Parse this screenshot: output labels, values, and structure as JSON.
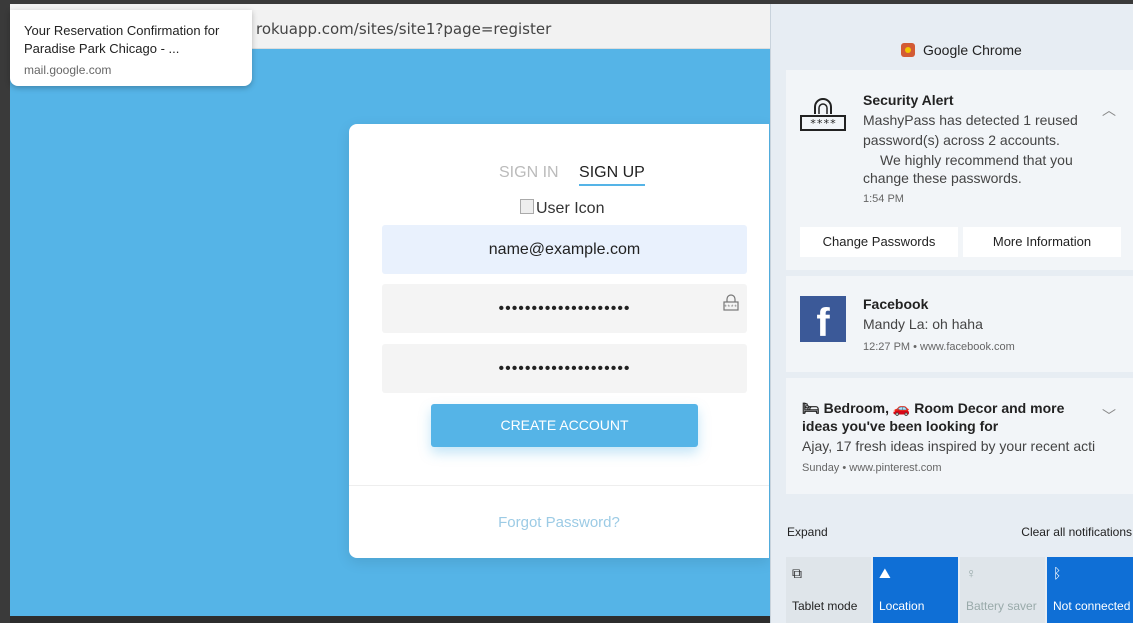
{
  "browser": {
    "url": "rokuapp.com/sites/site1?page=register"
  },
  "tooltip": {
    "title": "Your Reservation Confirmation for Paradise Park Chicago - ...",
    "source": "mail.google.com"
  },
  "form": {
    "tab_signin": "SIGN IN",
    "tab_signup": "SIGN UP",
    "user_icon_alt": "User Icon",
    "email": "name@example.com",
    "password": "••••••••••••••••••••",
    "confirm_password": "••••••••••••••••••••",
    "create_button": "CREATE ACCOUNT",
    "forgot": "Forgot Password?"
  },
  "action_center": {
    "app": "Google Chrome",
    "security": {
      "title": "Security Alert",
      "line1": "MashyPass has detected 1 reused",
      "line2": "password(s) across 2 accounts.",
      "line3": "We highly recommend that you",
      "line4": "change these passwords.",
      "time": "1:54 PM",
      "btn1": "Change Passwords",
      "btn2": "More Information"
    },
    "facebook": {
      "title": "Facebook",
      "body": "Mandy La: oh haha",
      "meta": "12:27 PM • www.facebook.com"
    },
    "pinterest": {
      "title1": "🛏 Bedroom, 🚗 Room Decor and more",
      "title2": "ideas you've been looking for",
      "body": "Ajay, 17 fresh ideas inspired by your recent acti",
      "meta": "Sunday • www.pinterest.com"
    },
    "expand": "Expand",
    "clear": "Clear all notifications",
    "quick_actions": [
      {
        "label": "Tablet mode",
        "icon": "tablet-mode-icon"
      },
      {
        "label": "Location",
        "icon": "location-icon"
      },
      {
        "label": "Battery saver",
        "icon": "battery-saver-icon"
      },
      {
        "label": "Not connected",
        "icon": "bluetooth-icon"
      }
    ]
  },
  "colors": {
    "page_bg": "#55b4e7",
    "accent": "#55b4e7",
    "ac_blue": "#0f6fd6",
    "facebook": "#3b5998"
  }
}
